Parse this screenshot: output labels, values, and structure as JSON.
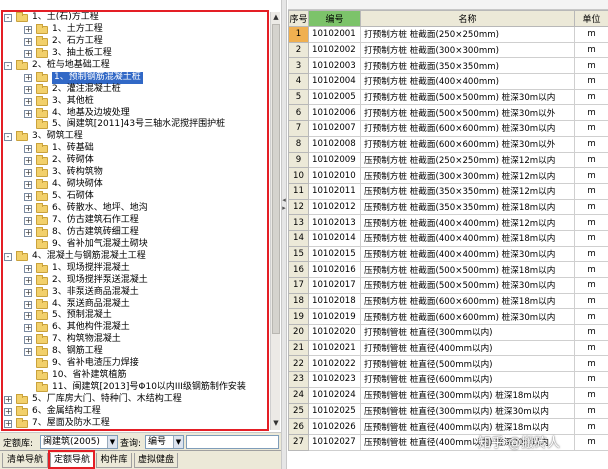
{
  "tree": {
    "items": [
      {
        "indent": 0,
        "exp": "-",
        "label": "1、土(石)方工程"
      },
      {
        "indent": 1,
        "exp": "+",
        "label": "1、土方工程"
      },
      {
        "indent": 1,
        "exp": "+",
        "label": "2、石方工程"
      },
      {
        "indent": 1,
        "exp": "+",
        "label": "3、抽土板工程"
      },
      {
        "indent": 0,
        "exp": "-",
        "label": "2、桩与地基础工程"
      },
      {
        "indent": 1,
        "exp": "+",
        "label": "1、预制钢筋混凝土桩",
        "selected": true
      },
      {
        "indent": 1,
        "exp": "+",
        "label": "2、灌注混凝土桩"
      },
      {
        "indent": 1,
        "exp": "+",
        "label": "3、其他桩"
      },
      {
        "indent": 1,
        "exp": "+",
        "label": "4、地基及边坡处理"
      },
      {
        "indent": 1,
        "exp": "",
        "label": "5、闽建筑[2011]43号三轴水泥搅拌围护桩"
      },
      {
        "indent": 0,
        "exp": "-",
        "label": "3、砌筑工程"
      },
      {
        "indent": 1,
        "exp": "+",
        "label": "1、砖基础"
      },
      {
        "indent": 1,
        "exp": "+",
        "label": "2、砖砌体"
      },
      {
        "indent": 1,
        "exp": "+",
        "label": "3、砖构筑物"
      },
      {
        "indent": 1,
        "exp": "+",
        "label": "4、砌块砌体"
      },
      {
        "indent": 1,
        "exp": "+",
        "label": "5、石砌体"
      },
      {
        "indent": 1,
        "exp": "+",
        "label": "6、砖散水、地坪、地沟"
      },
      {
        "indent": 1,
        "exp": "+",
        "label": "7、仿古建筑石作工程"
      },
      {
        "indent": 1,
        "exp": "+",
        "label": "8、仿古建筑砖细工程"
      },
      {
        "indent": 1,
        "exp": "",
        "label": "9、省补加气混凝土砌块"
      },
      {
        "indent": 0,
        "exp": "-",
        "label": "4、混凝土与钢筋混凝土工程"
      },
      {
        "indent": 1,
        "exp": "+",
        "label": "1、现场搅拌混凝土"
      },
      {
        "indent": 1,
        "exp": "+",
        "label": "2、现场搅拌泵送混凝土"
      },
      {
        "indent": 1,
        "exp": "+",
        "label": "3、非泵送商品混凝土"
      },
      {
        "indent": 1,
        "exp": "+",
        "label": "4、泵送商品混凝土"
      },
      {
        "indent": 1,
        "exp": "+",
        "label": "5、预制混凝土"
      },
      {
        "indent": 1,
        "exp": "+",
        "label": "6、其他构件混凝土"
      },
      {
        "indent": 1,
        "exp": "+",
        "label": "7、构筑物混凝土"
      },
      {
        "indent": 1,
        "exp": "+",
        "label": "8、钢筋工程"
      },
      {
        "indent": 1,
        "exp": "",
        "label": "9、省补电渣压力焊接"
      },
      {
        "indent": 1,
        "exp": "",
        "label": "10、省补建筑植筋"
      },
      {
        "indent": 1,
        "exp": "",
        "label": "11、闽建筑[2013]号Φ10以内III级钢筋制作安装"
      },
      {
        "indent": 0,
        "exp": "+",
        "label": "5、厂库房大门、特种门、木结构工程"
      },
      {
        "indent": 0,
        "exp": "+",
        "label": "6、金属结构工程"
      },
      {
        "indent": 0,
        "exp": "+",
        "label": "7、屋面及防水工程"
      }
    ]
  },
  "lookup": {
    "library_label": "定额库:",
    "library_value": "闽建筑(2005)",
    "query_label": "查询:",
    "query_field": "编号",
    "query_value": ""
  },
  "tabs": [
    {
      "label": "清单导航",
      "active": false
    },
    {
      "label": "定额导航",
      "active": true
    },
    {
      "label": "构件库",
      "active": false
    },
    {
      "label": "虚拟健盘",
      "active": false
    }
  ],
  "table": {
    "headers": {
      "seq": "序号",
      "code": "编号",
      "name": "名称",
      "unit": "单位"
    },
    "rows": [
      {
        "seq": "1",
        "code": "10102001",
        "name": "打预制方桩 桩截面(250×250mm)",
        "unit": "m"
      },
      {
        "seq": "2",
        "code": "10102002",
        "name": "打预制方桩 桩截面(300×300mm)",
        "unit": "m"
      },
      {
        "seq": "3",
        "code": "10102003",
        "name": "打预制方桩 桩截面(350×350mm)",
        "unit": "m"
      },
      {
        "seq": "4",
        "code": "10102004",
        "name": "打预制方桩 桩截面(400×400mm)",
        "unit": "m"
      },
      {
        "seq": "5",
        "code": "10102005",
        "name": "打预制方桩 桩截面(500×500mm)  桩深30m以内",
        "unit": "m"
      },
      {
        "seq": "6",
        "code": "10102006",
        "name": "打预制方桩 桩截面(500×500mm)  桩深30m以外",
        "unit": "m"
      },
      {
        "seq": "7",
        "code": "10102007",
        "name": "打预制方桩 桩截面(600×600mm)  桩深30m以内",
        "unit": "m"
      },
      {
        "seq": "8",
        "code": "10102008",
        "name": "打预制方桩 桩截面(600×600mm)  桩深30m以外",
        "unit": "m"
      },
      {
        "seq": "9",
        "code": "10102009",
        "name": "压预制方桩 桩截面(250×250mm)  桩深12m以内",
        "unit": "m"
      },
      {
        "seq": "10",
        "code": "10102010",
        "name": "压预制方桩 桩截面(300×300mm)  桩深12m以内",
        "unit": "m"
      },
      {
        "seq": "11",
        "code": "10102011",
        "name": "压预制方桩 桩截面(350×350mm)  桩深12m以内",
        "unit": "m"
      },
      {
        "seq": "12",
        "code": "10102012",
        "name": "压预制方桩 桩截面(350×350mm)  桩深18m以内",
        "unit": "m"
      },
      {
        "seq": "13",
        "code": "10102013",
        "name": "压预制方桩 桩截面(400×400mm)  桩深12m以内",
        "unit": "m"
      },
      {
        "seq": "14",
        "code": "10102014",
        "name": "压预制方桩 桩截面(400×400mm)  桩深18m以内",
        "unit": "m"
      },
      {
        "seq": "15",
        "code": "10102015",
        "name": "压预制方桩 桩截面(400×400mm)  桩深30m以内",
        "unit": "m"
      },
      {
        "seq": "16",
        "code": "10102016",
        "name": "压预制方桩 桩截面(500×500mm)  桩深18m以内",
        "unit": "m"
      },
      {
        "seq": "17",
        "code": "10102017",
        "name": "压预制方桩 桩截面(500×500mm)  桩深30m以内",
        "unit": "m"
      },
      {
        "seq": "18",
        "code": "10102018",
        "name": "压预制方桩 桩截面(600×600mm)  桩深18m以内",
        "unit": "m"
      },
      {
        "seq": "19",
        "code": "10102019",
        "name": "压预制方桩 桩截面(600×600mm)  桩深30m以内",
        "unit": "m"
      },
      {
        "seq": "20",
        "code": "10102020",
        "name": "打预制管桩 桩直径(300mm以内)",
        "unit": "m"
      },
      {
        "seq": "21",
        "code": "10102021",
        "name": "打预制管桩 桩直径(400mm以内)",
        "unit": "m"
      },
      {
        "seq": "22",
        "code": "10102022",
        "name": "打预制管桩 桩直径(500mm以内)",
        "unit": "m"
      },
      {
        "seq": "23",
        "code": "10102023",
        "name": "打预制管桩 桩直径(600mm以内)",
        "unit": "m"
      },
      {
        "seq": "24",
        "code": "10102024",
        "name": "压预制管桩 桩直径(300mm以内)  桩深18m以内",
        "unit": "m"
      },
      {
        "seq": "25",
        "code": "10102025",
        "name": "压预制管桩 桩直径(300mm以内)  桩深30m以内",
        "unit": "m"
      },
      {
        "seq": "26",
        "code": "10102026",
        "name": "压预制管桩 桩直径(400mm以内)  桩深18m以内",
        "unit": "m"
      },
      {
        "seq": "27",
        "code": "10102027",
        "name": "压预制管桩 桩直径(400mm以内)  桩深30m以内",
        "unit": "m"
      }
    ]
  },
  "watermark": "知乎 @搬砖人",
  "colors": {
    "highlight_red": "#e41e25",
    "selection_blue": "#3168c6",
    "header_green": "#7cc36a",
    "row_selected": "#f0b050"
  }
}
